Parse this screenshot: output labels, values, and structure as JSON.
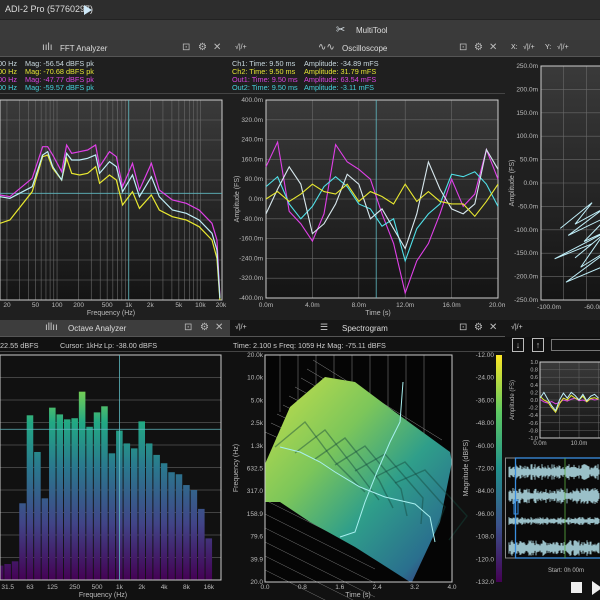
{
  "titlebar": {
    "device": "ADI-2 Pro (57760297)",
    "play_icon": "play-icon"
  },
  "toolbar": {
    "title": "MultiTool",
    "icon": "multitool-icon"
  },
  "colors": {
    "ch1": "#c8d8de",
    "ch2": "#e4e434",
    "out1": "#d844e0",
    "out2": "#46d2dc",
    "cursor": "#5fb8c0",
    "accent_blue": "#3a8ee0"
  },
  "fft": {
    "title": "FFT Analyzer",
    "channel_select_icon": "waveform-add-icon",
    "info": [
      {
        "freq": "00 Hz",
        "mag": "Mag: -56.54 dBFS pk",
        "color": "#c8d8de"
      },
      {
        "freq": "00 Hz",
        "mag": "Mag: -70.68 dBFS pk",
        "color": "#e4e434"
      },
      {
        "freq": "00 Hz",
        "mag": "Mag: -47.77 dBFS pk",
        "color": "#d844e0"
      },
      {
        "freq": "00 Hz",
        "mag": "Mag: -59.57 dBFS pk",
        "color": "#46d2dc"
      }
    ]
  },
  "osc": {
    "title": "Oscilloscope",
    "channel_select": "√|/+",
    "info": [
      {
        "ch": "Ch1:  Time: 9.50 ms",
        "amp": "Amplitude: -34.89 mFS",
        "color": "#c8d8de"
      },
      {
        "ch": "Ch2:  Time: 9.50 ms",
        "amp": "Amplitude: 31.79 mFS",
        "color": "#e4e434"
      },
      {
        "ch": "Out1:  Time: 9.50 ms",
        "amp": "Amplitude: 63.54 mFS",
        "color": "#d844e0"
      },
      {
        "ch": "Out2:  Time: 9.50 ms",
        "amp": "Amplitude: -3.11 mFS",
        "color": "#46d2dc"
      }
    ]
  },
  "xy": {
    "x_label": "X:",
    "y_label": "Y:",
    "x_select": "√|/+",
    "y_select": "√|/+"
  },
  "octave": {
    "title": "Octave Analyzer",
    "info_left": "22.55 dBFS",
    "cursor": "Cursor: 1kHz",
    "lp": "Lp: -38.00 dBFS"
  },
  "spectrogram": {
    "title": "Spectrogram",
    "channel_select": "√|/+",
    "info": "Time: 2.100 s   Freq: 1059 Hz   Mag: -75.11 dBFS"
  },
  "recorder": {
    "channel_select": "√|/+",
    "import_icon": "import-icon",
    "export_icon": "export-icon",
    "name_value": "",
    "start": "Start: 0h 00m"
  },
  "chart_data": [
    {
      "id": "fft",
      "type": "line",
      "xlabel": "Frequency (Hz)",
      "xscale": "log",
      "xlim": [
        16,
        20000
      ],
      "ylim": [
        -120,
        0
      ],
      "xticks": [
        {
          "v": 20,
          "l": "20"
        },
        {
          "v": 50,
          "l": "50"
        },
        {
          "v": 100,
          "l": "100"
        },
        {
          "v": 200,
          "l": "200"
        },
        {
          "v": 500,
          "l": "500"
        },
        {
          "v": 1000,
          "l": "1k"
        },
        {
          "v": 2000,
          "l": "2k"
        },
        {
          "v": 5000,
          "l": "5k"
        },
        {
          "v": 10000,
          "l": "10k"
        },
        {
          "v": 20000,
          "l": "20k"
        }
      ],
      "cursor": {
        "x": 1000,
        "y": -56
      },
      "x": [
        16,
        22,
        45,
        63,
        74,
        87,
        116,
        136,
        160,
        206,
        267,
        345,
        392,
        539,
        672,
        820,
        1128,
        1410,
        2070,
        2670,
        4060,
        6350,
        9580,
        14500,
        17000,
        18700
      ],
      "series": [
        {
          "color": "#e040e8",
          "values": [
            -57,
            -58,
            -47,
            -28,
            -28,
            -33,
            -43,
            -27,
            -32,
            -31,
            -30,
            -27,
            -40,
            -31,
            -34,
            -52,
            -38,
            -54,
            -38,
            -54,
            -60,
            -62,
            -66,
            -74,
            -84,
            -118
          ]
        },
        {
          "color": "#e8e830",
          "values": [
            -74,
            -72,
            -55,
            -34,
            -33,
            -41,
            -48,
            -35,
            -44,
            -45,
            -44,
            -40,
            -50,
            -45,
            -48,
            -63,
            -55,
            -65,
            -57,
            -66,
            -70,
            -72,
            -76,
            -84,
            -95,
            -120
          ]
        },
        {
          "color": "#bfeef8",
          "values": [
            -58,
            -59,
            -52,
            -33,
            -31,
            -40,
            -48,
            -32,
            -36,
            -36,
            -35,
            -33,
            -44,
            -37,
            -40,
            -55,
            -45,
            -58,
            -46,
            -58,
            -66,
            -68,
            -72,
            -80,
            -90,
            -119
          ]
        }
      ]
    },
    {
      "id": "osc",
      "type": "line",
      "xlabel": "Time (s)",
      "ylabel": "Amplitude (FS)",
      "xlim": [
        0,
        20
      ],
      "ylim": [
        -400,
        400
      ],
      "xticks": [
        "0.0m",
        "4.0m",
        "8.0m",
        "12.0m",
        "16.0m",
        "20.0m"
      ],
      "yticks": [
        "400.0m",
        "320.0m",
        "240.0m",
        "160.0m",
        "80.0m",
        "0.0m",
        "-80.0m",
        "-160.0m",
        "-240.0m",
        "-320.0m",
        "-400.0m"
      ],
      "cursor_x": 9.5,
      "x": [
        0,
        1,
        2,
        3,
        4,
        5,
        6,
        7,
        8,
        9,
        10,
        11,
        12,
        13,
        14,
        15,
        16,
        17,
        18,
        19,
        20
      ],
      "series": [
        {
          "color": "#e040e8",
          "values": [
            130,
            230,
            -50,
            -100,
            -170,
            -60,
            220,
            150,
            120,
            80,
            -60,
            -180,
            -380,
            -250,
            -180,
            -60,
            80,
            -30,
            20,
            200,
            80
          ]
        },
        {
          "color": "#50e0e8",
          "values": [
            50,
            90,
            -20,
            -80,
            -30,
            50,
            90,
            50,
            -20,
            -40,
            -110,
            -80,
            -250,
            -120,
            -60,
            -20,
            100,
            90,
            110,
            60,
            -30
          ]
        },
        {
          "color": "#d8e8ee",
          "values": [
            -60,
            40,
            130,
            60,
            -140,
            -100,
            -20,
            100,
            60,
            -80,
            -40,
            -120,
            -200,
            -60,
            150,
            40,
            -40,
            -60,
            -20,
            200,
            120
          ]
        },
        {
          "color": "#e8e830",
          "values": [
            0,
            30,
            -10,
            20,
            60,
            30,
            20,
            60,
            -10,
            30,
            10,
            -20,
            60,
            -10,
            30,
            -10,
            -20,
            -20,
            -70,
            -10,
            60
          ]
        }
      ]
    },
    {
      "id": "xy",
      "type": "line",
      "ylabel": "Amplitude (FS)",
      "xlim": [
        -100,
        -48
      ],
      "ylim": [
        -250,
        250
      ],
      "xticks": [
        {
          "v": -100,
          "l": "-100.0m"
        },
        {
          "v": -60,
          "l": "-60.0m"
        }
      ],
      "yticks": [
        "250.0m",
        "200.0m",
        "150.0m",
        "100.0m",
        "50.0m",
        "0.0m",
        "-50.0m",
        "-100.0m",
        "-150.0m",
        "-200.0m",
        "-250.0m"
      ],
      "points": [
        [
          -83,
          -97
        ],
        [
          -55,
          -42
        ],
        [
          -70,
          -88
        ],
        [
          -45,
          -55
        ],
        [
          -76,
          -112
        ],
        [
          -40,
          -70
        ],
        [
          -62,
          -125
        ],
        [
          -35,
          -95
        ],
        [
          -88,
          -162
        ],
        [
          -55,
          -130
        ],
        [
          -70,
          -160
        ],
        [
          -45,
          -110
        ],
        [
          -65,
          -180
        ],
        [
          -38,
          -140
        ],
        [
          -78,
          -212
        ],
        [
          -42,
          -175
        ],
        [
          -30,
          -150
        ]
      ]
    },
    {
      "id": "octave",
      "type": "bar",
      "xlabel": "Frequency (Hz)",
      "level_scale": "fraction of plot height",
      "categories": [
        "25",
        "31.5",
        "40",
        "50",
        "63",
        "80",
        "100",
        "125",
        "160",
        "200",
        "250",
        "315",
        "400",
        "500",
        "630",
        "800",
        "1k",
        "1.25k",
        "1.6k",
        "2k",
        "2.5k",
        "3.15k",
        "4k",
        "5k",
        "6.3k",
        "8k",
        "10k",
        "12.5k",
        "16k"
      ],
      "tick_labels": [
        "31.5",
        "63",
        "125",
        "250",
        "500",
        "1k",
        "2k",
        "4k",
        "8k",
        "16k"
      ],
      "values": [
        0.064,
        0.071,
        0.083,
        0.341,
        0.732,
        0.569,
        0.363,
        0.766,
        0.736,
        0.714,
        0.719,
        0.837,
        0.681,
        0.745,
        0.772,
        0.563,
        0.664,
        0.607,
        0.585,
        0.705,
        0.607,
        0.556,
        0.519,
        0.479,
        0.47,
        0.422,
        0.4,
        0.316,
        0.185
      ],
      "cursor": "1k"
    },
    {
      "id": "spectrogram",
      "type": "heatmap",
      "xlabel": "Time (s)",
      "ylabel": "Frequency (Hz)",
      "colorbar_label": "Magnitude (dBFS)",
      "xticks": [
        "0.0",
        "0.8",
        "1.6",
        "2.4",
        "3.2",
        "4.0"
      ],
      "yticks": [
        "20.0k",
        "10.0k",
        "5.0k",
        "2.5k",
        "1.3k",
        "632.5",
        "317.0",
        "158.9",
        "79.6",
        "39.9",
        "20.0"
      ],
      "colorbar_ticks": [
        "-12.00",
        "-24.00",
        "-36.00",
        "-48.00",
        "-60.00",
        "-72.00",
        "-84.00",
        "-96.00",
        "-108.0",
        "-120.0",
        "-132.0"
      ],
      "colormap": "viridis"
    },
    {
      "id": "recorder_scope",
      "type": "line",
      "ylabel": "Amplitude (FS)",
      "ylim": [
        -1,
        1
      ],
      "xticks": [
        "0.0m",
        "10.0m"
      ],
      "yticks": [
        "1.0",
        "0.8",
        "0.6",
        "0.4",
        "0.2",
        "0.0",
        "-0.2",
        "-0.4",
        "-0.6",
        "-0.8",
        "-1.0"
      ],
      "x": [
        0,
        1,
        2,
        3,
        4,
        5,
        6,
        7,
        8,
        9,
        10,
        11,
        12,
        13,
        14,
        15
      ],
      "series": [
        {
          "color": "#d844e0",
          "values": [
            0.02,
            -0.05,
            -0.08,
            -0.04,
            -0.1,
            -0.06,
            0.0,
            -0.03,
            0.02,
            0.05,
            -0.02,
            0.0,
            -0.04,
            0.03,
            0.0,
            0.02
          ]
        },
        {
          "color": "#e8e830",
          "values": [
            0.1,
            0.0,
            -0.05,
            -0.2,
            -0.32,
            -0.1,
            0.05,
            0.0,
            0.12,
            0.05,
            0.0,
            0.1,
            -0.05,
            0.04,
            0.06,
            0.02
          ]
        },
        {
          "color": "#bfeef8",
          "values": [
            0.05,
            0.2,
            0.02,
            -0.15,
            -0.28,
            0.0,
            0.18,
            0.05,
            0.2,
            0.12,
            0.0,
            0.15,
            -0.02,
            0.1,
            0.15,
            0.05
          ]
        }
      ]
    }
  ]
}
